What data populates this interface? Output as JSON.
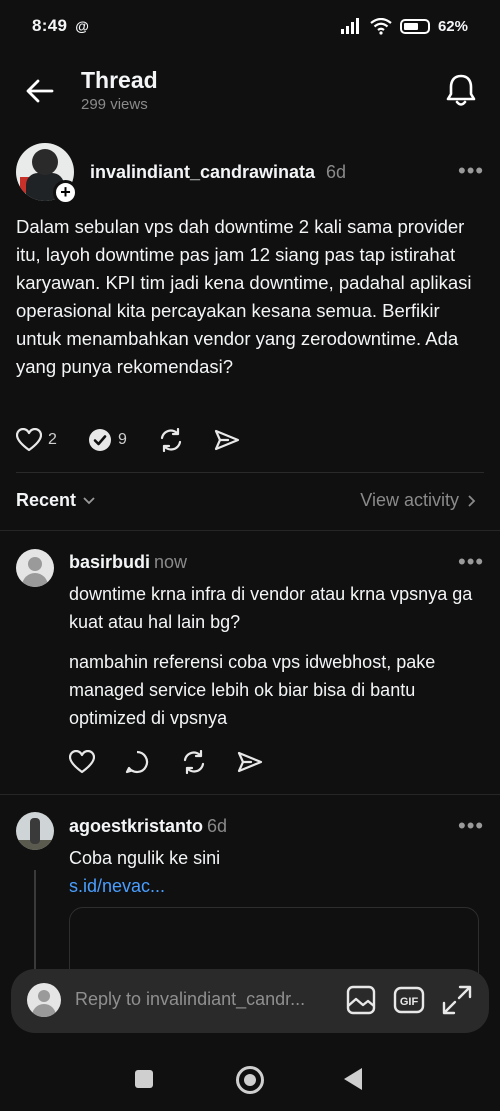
{
  "status": {
    "time": "8:49",
    "app_glyph": "@",
    "battery": "62%",
    "battery_level": 0.62
  },
  "header": {
    "title": "Thread",
    "views": "299 views"
  },
  "post": {
    "username": "invalindiant_candrawinata",
    "time": "6d",
    "text": "Dalam sebulan vps dah downtime 2 kali sama provider itu, layoh downtime pas jam 12 siang pas tap istirahat karyawan. KPI tim jadi kena downtime, padahal aplikasi operasional kita percayakan kesana semua. Berfikir untuk menambahkan vendor yang zerodowntime. Ada yang punya rekomendasi?",
    "likes": "2",
    "replies": "9"
  },
  "sort": {
    "recent_label": "Recent",
    "view_activity": "View activity"
  },
  "replies": [
    {
      "username": "basirbudi",
      "time": "now",
      "paragraphs": [
        "downtime krna infra di vendor atau krna vpsnya ga kuat atau hal lain bg?",
        "nambahin referensi coba vps idwebhost, pake managed service lebih ok biar bisa di bantu optimized di vpsnya"
      ]
    },
    {
      "username": "agoestkristanto",
      "time": "6d",
      "text": "Coba ngulik ke sini",
      "link": "s.id/nevac..."
    }
  ],
  "reply_bar": {
    "placeholder": "Reply to invalindiant_candr...",
    "gif_label": "GIF"
  },
  "icons": [
    "back-arrow-icon",
    "bell-icon",
    "heart-icon",
    "reply-icon",
    "repost-icon",
    "share-icon",
    "chevron-down-icon",
    "chevron-right-icon",
    "image-icon",
    "gif-icon",
    "expand-icon"
  ]
}
